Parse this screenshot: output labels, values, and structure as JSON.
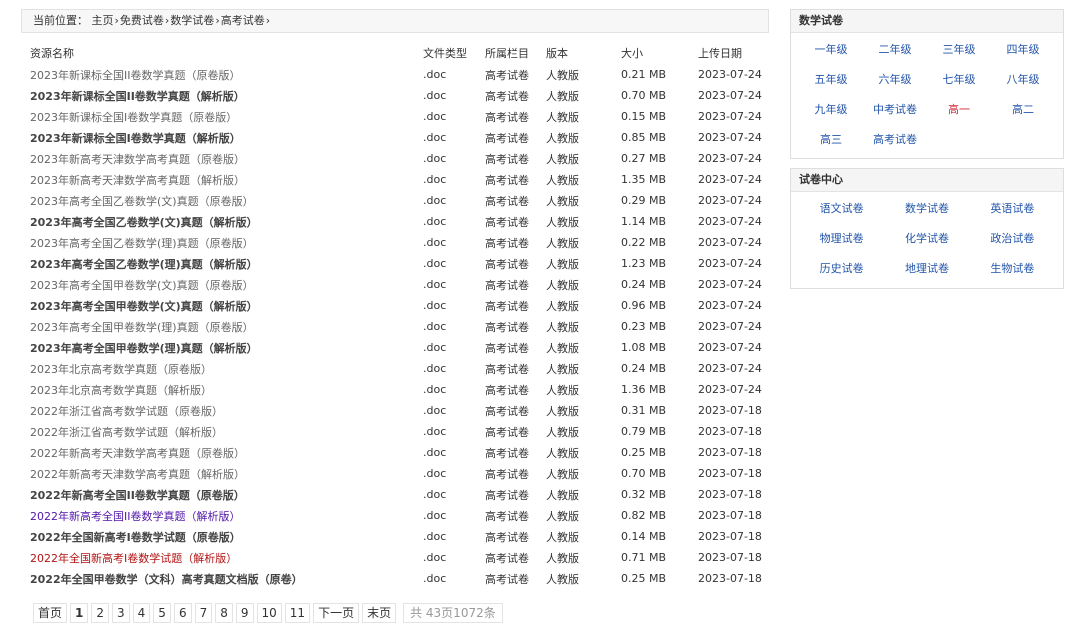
{
  "breadcrumb": {
    "prefix": "当前位置：",
    "items": [
      "主页",
      "免费试卷",
      "数学试卷",
      "高考试卷"
    ],
    "sep": "›"
  },
  "table": {
    "headers": [
      "资源名称",
      "文件类型",
      "所属栏目",
      "版本",
      "大小",
      "上传日期"
    ],
    "rows": [
      {
        "name": "2023年新课标全国II卷数学真题（原卷版）",
        "type": ".doc",
        "column": "高考试卷",
        "version": "人教版",
        "size": "0.21 MB",
        "date": "2023-07-24",
        "style": "normal"
      },
      {
        "name": "2023年新课标全国II卷数学真题（解析版）",
        "type": ".doc",
        "column": "高考试卷",
        "version": "人教版",
        "size": "0.70 MB",
        "date": "2023-07-24",
        "style": "bold"
      },
      {
        "name": "2023年新课标全国I卷数学真题（原卷版）",
        "type": ".doc",
        "column": "高考试卷",
        "version": "人教版",
        "size": "0.15 MB",
        "date": "2023-07-24",
        "style": "normal"
      },
      {
        "name": "2023年新课标全国I卷数学真题（解析版）",
        "type": ".doc",
        "column": "高考试卷",
        "version": "人教版",
        "size": "0.85 MB",
        "date": "2023-07-24",
        "style": "bold"
      },
      {
        "name": "2023年新高考天津数学高考真题（原卷版）",
        "type": ".doc",
        "column": "高考试卷",
        "version": "人教版",
        "size": "0.27 MB",
        "date": "2023-07-24",
        "style": "normal"
      },
      {
        "name": "2023年新高考天津数学高考真题（解析版）",
        "type": ".doc",
        "column": "高考试卷",
        "version": "人教版",
        "size": "1.35 MB",
        "date": "2023-07-24",
        "style": "normal"
      },
      {
        "name": "2023年高考全国乙卷数学(文)真题（原卷版）",
        "type": ".doc",
        "column": "高考试卷",
        "version": "人教版",
        "size": "0.29 MB",
        "date": "2023-07-24",
        "style": "normal"
      },
      {
        "name": "2023年高考全国乙卷数学(文)真题（解析版）",
        "type": ".doc",
        "column": "高考试卷",
        "version": "人教版",
        "size": "1.14 MB",
        "date": "2023-07-24",
        "style": "bold"
      },
      {
        "name": "2023年高考全国乙卷数学(理)真题（原卷版）",
        "type": ".doc",
        "column": "高考试卷",
        "version": "人教版",
        "size": "0.22 MB",
        "date": "2023-07-24",
        "style": "normal"
      },
      {
        "name": "2023年高考全国乙卷数学(理)真题（解析版）",
        "type": ".doc",
        "column": "高考试卷",
        "version": "人教版",
        "size": "1.23 MB",
        "date": "2023-07-24",
        "style": "bold"
      },
      {
        "name": "2023年高考全国甲卷数学(文)真题（原卷版）",
        "type": ".doc",
        "column": "高考试卷",
        "version": "人教版",
        "size": "0.24 MB",
        "date": "2023-07-24",
        "style": "normal"
      },
      {
        "name": "2023年高考全国甲卷数学(文)真题（解析版）",
        "type": ".doc",
        "column": "高考试卷",
        "version": "人教版",
        "size": "0.96 MB",
        "date": "2023-07-24",
        "style": "bold"
      },
      {
        "name": "2023年高考全国甲卷数学(理)真题（原卷版）",
        "type": ".doc",
        "column": "高考试卷",
        "version": "人教版",
        "size": "0.23 MB",
        "date": "2023-07-24",
        "style": "normal"
      },
      {
        "name": "2023年高考全国甲卷数学(理)真题（解析版）",
        "type": ".doc",
        "column": "高考试卷",
        "version": "人教版",
        "size": "1.08 MB",
        "date": "2023-07-24",
        "style": "bold"
      },
      {
        "name": "2023年北京高考数学真题（原卷版）",
        "type": ".doc",
        "column": "高考试卷",
        "version": "人教版",
        "size": "0.24 MB",
        "date": "2023-07-24",
        "style": "normal"
      },
      {
        "name": "2023年北京高考数学真题（解析版）",
        "type": ".doc",
        "column": "高考试卷",
        "version": "人教版",
        "size": "1.36 MB",
        "date": "2023-07-24",
        "style": "normal"
      },
      {
        "name": "2022年浙江省高考数学试题（原卷版）",
        "type": ".doc",
        "column": "高考试卷",
        "version": "人教版",
        "size": "0.31 MB",
        "date": "2023-07-18",
        "style": "normal"
      },
      {
        "name": "2022年浙江省高考数学试题（解析版）",
        "type": ".doc",
        "column": "高考试卷",
        "version": "人教版",
        "size": "0.79 MB",
        "date": "2023-07-18",
        "style": "normal"
      },
      {
        "name": "2022年新高考天津数学高考真题（原卷版）",
        "type": ".doc",
        "column": "高考试卷",
        "version": "人教版",
        "size": "0.25 MB",
        "date": "2023-07-18",
        "style": "normal"
      },
      {
        "name": "2022年新高考天津数学高考真题（解析版）",
        "type": ".doc",
        "column": "高考试卷",
        "version": "人教版",
        "size": "0.70 MB",
        "date": "2023-07-18",
        "style": "normal"
      },
      {
        "name": "2022年新高考全国II卷数学真题（原卷版）",
        "type": ".doc",
        "column": "高考试卷",
        "version": "人教版",
        "size": "0.32 MB",
        "date": "2023-07-18",
        "style": "bold"
      },
      {
        "name": "2022年新高考全国II卷数学真题（解析版）",
        "type": ".doc",
        "column": "高考试卷",
        "version": "人教版",
        "size": "0.82 MB",
        "date": "2023-07-18",
        "style": "purple"
      },
      {
        "name": "2022年全国新高考I卷数学试题（原卷版）",
        "type": ".doc",
        "column": "高考试卷",
        "version": "人教版",
        "size": "0.14 MB",
        "date": "2023-07-18",
        "style": "bold"
      },
      {
        "name": "2022年全国新高考I卷数学试题（解析版）",
        "type": ".doc",
        "column": "高考试卷",
        "version": "人教版",
        "size": "0.71 MB",
        "date": "2023-07-18",
        "style": "red"
      },
      {
        "name": "2022年全国甲卷数学（文科）高考真题文档版（原卷）",
        "type": ".doc",
        "column": "高考试卷",
        "version": "人教版",
        "size": "0.25 MB",
        "date": "2023-07-18",
        "style": "bold"
      }
    ]
  },
  "pager": {
    "first": "首页",
    "pages": [
      "1",
      "2",
      "3",
      "4",
      "5",
      "6",
      "7",
      "8",
      "9",
      "10",
      "11"
    ],
    "current": "1",
    "next": "下一页",
    "last": "末页",
    "total": "共 43页1072条"
  },
  "math_box": {
    "title": "数学试卷",
    "items": [
      "一年级",
      "二年级",
      "三年级",
      "四年级",
      "五年级",
      "六年级",
      "七年级",
      "八年级",
      "九年级",
      "中考试卷",
      "高一",
      "高二",
      "高三",
      "高考试卷"
    ],
    "active": "高一"
  },
  "center_box": {
    "title": "试卷中心",
    "items": [
      "语文试卷",
      "数学试卷",
      "英语试卷",
      "物理试卷",
      "化学试卷",
      "政治试卷",
      "历史试卷",
      "地理试卷",
      "生物试卷"
    ]
  }
}
